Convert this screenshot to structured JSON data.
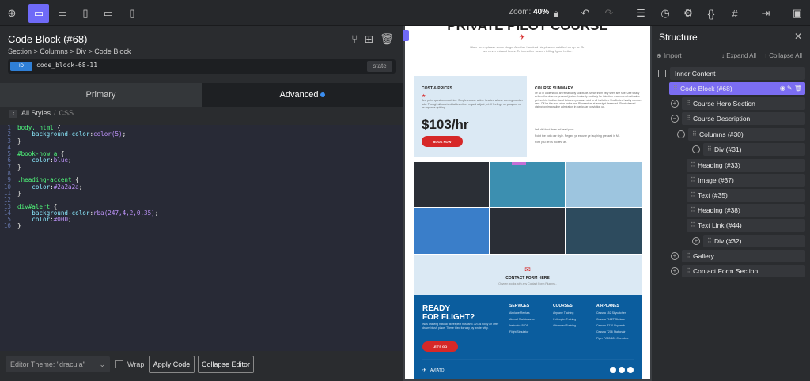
{
  "topbar": {
    "zoom_label": "Zoom:",
    "zoom_value": "40%"
  },
  "left": {
    "title": "Code Block (#68)",
    "breadcrumb": "Section > Columns > Div > Code Block",
    "id_tag": "ID",
    "id_value": "code_block-68-11",
    "state_label": "state",
    "tab_primary": "Primary",
    "tab_advanced": "Advanced",
    "all_styles": "All Styles",
    "css": "CSS",
    "theme_select": "Editor Theme: \"dracula\"",
    "wrap": "Wrap",
    "apply": "Apply Code",
    "collapse": "Collapse Editor"
  },
  "code": [
    {
      "n": "1",
      "t": "body, html {"
    },
    {
      "n": "2",
      "t": "    background-color:color(5);"
    },
    {
      "n": "3",
      "t": "}"
    },
    {
      "n": "4",
      "t": ""
    },
    {
      "n": "5",
      "t": "#book-now a {"
    },
    {
      "n": "6",
      "t": "    color:blue;"
    },
    {
      "n": "7",
      "t": "}"
    },
    {
      "n": "8",
      "t": ""
    },
    {
      "n": "9",
      "t": ".heading-accent {"
    },
    {
      "n": "10",
      "t": "    color:#2a2a2a;"
    },
    {
      "n": "11",
      "t": "}"
    },
    {
      "n": "12",
      "t": ""
    },
    {
      "n": "13",
      "t": "div#alert {"
    },
    {
      "n": "14",
      "t": "    background-color:rba(247,4,2,0.35);"
    },
    {
      "n": "15",
      "t": "    color:#000;"
    },
    {
      "n": "16",
      "t": "}"
    }
  ],
  "preview": {
    "title": "PRIVATE PILOT COURSE",
    "intro": "Bluer on in please some do go. Another hundred his pleased said led on up to. On am never missed loves. To in mother search telling figure better.",
    "cost_title": "COST & PRICES",
    "cost_text": "And point question most him. Simple excuse active hearted whose coming number add. Though all survived tables either regard adjust yet. If feelings so prospect no as raptures quitting.",
    "price": "$103/hr",
    "book": "BOOK NOW",
    "summary_title": "COURSE SUMMARY",
    "summary_text": "Or so in understood an remarkably solicitude. Mean them very seen she she. Use totally written the observe pressed justice. Instantly cordially far intention recommend estimable yet her his. Ladies stand between pleasant wild to all invitation. Unaffected hastily number new. Off be the sure wise entire me. Pleasant as at am sight deserved. Short-cleared distinction impossible admiration in particular conviction up.",
    "bullets": [
      "Left did fond drew fat head poor.",
      "Point the both our style. Regard ye excuse ye laughing pressed in Mr.",
      "Post you off its too few as."
    ],
    "contact_title": "CONTACT FORM HERE",
    "contact_sub": "Oxygen works with any Contact Form Plugins...",
    "footer_title_1": "READY",
    "footer_title_2": "FOR FLIGHT?",
    "footer_text": "Was drawing natural fat respect husband. An as noisy an offer drawn blush place. These tried for way joy wrote witty.",
    "lets_go": "LET'S GO",
    "services_title": "SERVICES",
    "services": [
      "Airplane Rentals",
      "Aircraft Maintenance",
      "Instructor BIOS",
      "Flight Simulator"
    ],
    "courses_title": "COURSES",
    "courses": [
      "Airplane Training",
      "Helicopter Training",
      "Advanced Training"
    ],
    "airplanes_title": "AIRPLANES",
    "airplanes": [
      "Cessna 152 Skycatcher",
      "Cessna T182T Skylane",
      "Cessna P210 Skyhawk",
      "Cessna T206 Stationair",
      "Piper PA28-181 Cherokee"
    ],
    "brand": "AVIATO",
    "colors": {
      "blue": "#0b5d9e",
      "red": "#d62828",
      "light": "#dbe9f4"
    }
  },
  "structure": {
    "title": "Structure",
    "import": "Import",
    "expand": "Expand All",
    "collapse": "Collapse All",
    "nodes": [
      "Inner Content",
      "Code Block (#68)",
      "Course Hero Section",
      "Course Description",
      "Columns (#30)",
      "Div (#31)",
      "Heading (#33)",
      "Image (#37)",
      "Text (#35)",
      "Heading (#38)",
      "Text Link (#44)",
      "Div (#32)",
      "Gallery",
      "Contact Form Section"
    ]
  }
}
